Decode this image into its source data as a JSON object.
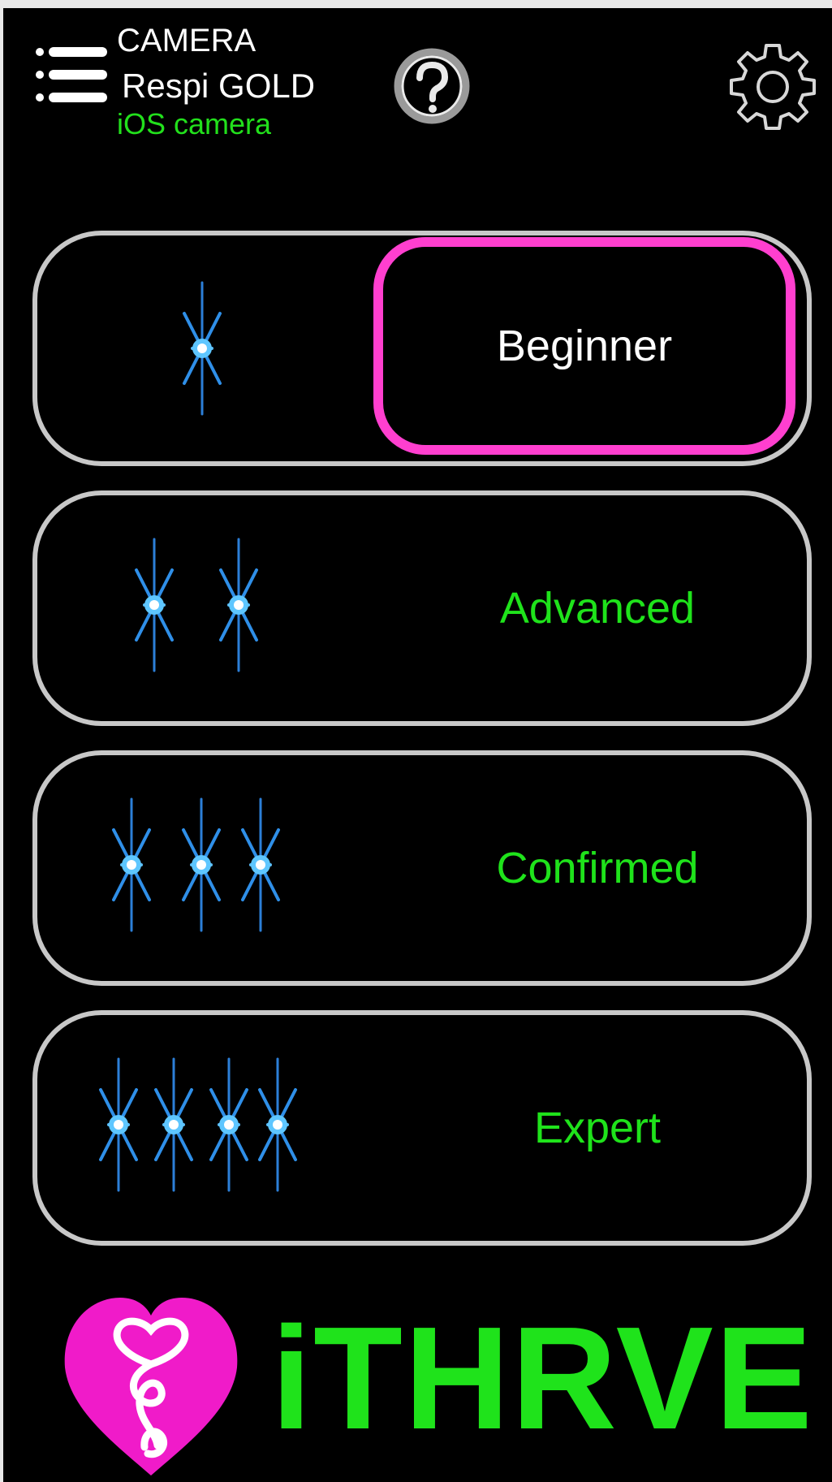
{
  "header": {
    "menu_icon": "list-menu-icon",
    "source_title": "CAMERA",
    "device_name": "Respi GOLD",
    "device_source": "iOS camera",
    "help_icon": "question-circle-icon",
    "settings_icon": "gear-icon"
  },
  "levels": [
    {
      "label": "Beginner",
      "stars": 1,
      "selected": true
    },
    {
      "label": "Advanced",
      "stars": 2,
      "selected": false
    },
    {
      "label": "Confirmed",
      "stars": 3,
      "selected": false
    },
    {
      "label": "Expert",
      "stars": 4,
      "selected": false
    }
  ],
  "logo": {
    "brand": "iTHRVE",
    "icon": "heart-logo-icon"
  },
  "colors": {
    "background": "#000000",
    "accent_green": "#1fe31b",
    "selected_magenta": "#ff3fcf",
    "card_border": "#c8c8c8",
    "star_blue": "#34a8ff"
  }
}
